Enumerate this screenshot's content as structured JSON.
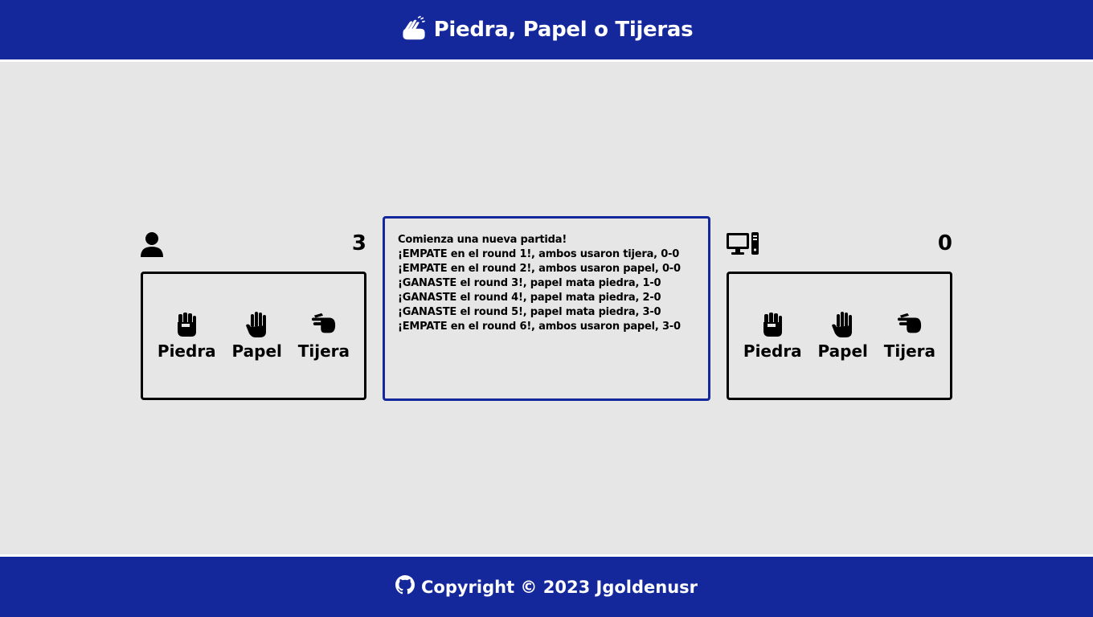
{
  "header": {
    "title": "Piedra, Papel o Tijeras",
    "icon": "hand-sign-icon",
    "background": "#14279b"
  },
  "player": {
    "icon": "user-icon",
    "score": "3",
    "choices": [
      {
        "label": "Piedra",
        "icon": "fist-icon"
      },
      {
        "label": "Papel",
        "icon": "open-hand-icon"
      },
      {
        "label": "Tijera",
        "icon": "scissors-hand-icon"
      }
    ]
  },
  "computer": {
    "icon": "desktop-computer-icon",
    "score": "0",
    "choices": [
      {
        "label": "Piedra",
        "icon": "fist-icon"
      },
      {
        "label": "Papel",
        "icon": "open-hand-icon"
      },
      {
        "label": "Tijera",
        "icon": "scissors-hand-icon"
      }
    ]
  },
  "log": {
    "lines": [
      "Comienza una nueva partida!",
      "¡EMPATE en el round 1!, ambos usaron tijera, 0-0",
      "¡EMPATE en el round 2!, ambos usaron papel, 0-0",
      "¡GANASTE el round 3!, papel mata piedra, 1-0",
      "¡GANASTE el round 4!, papel mata piedra, 2-0",
      "¡GANASTE el round 5!, papel mata piedra, 3-0",
      "¡EMPATE en el round 6!, ambos usaron papel, 3-0"
    ]
  },
  "footer": {
    "text": "Copyright © 2023 Jgoldenusr",
    "icon": "github-icon"
  }
}
